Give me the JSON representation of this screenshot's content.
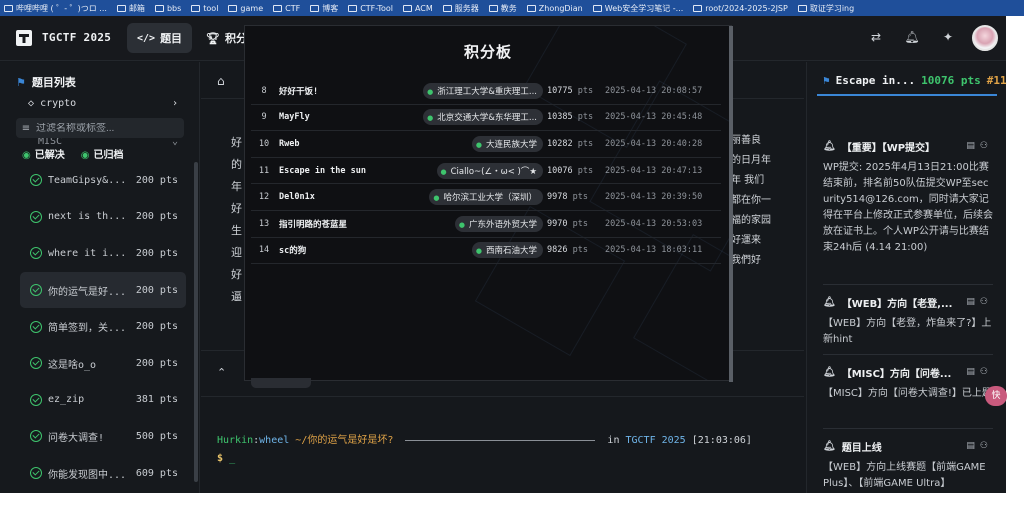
{
  "bookmarks": [
    {
      "label": "哔哩哔哩 ( ゜- ゜)つロ ..."
    },
    {
      "label": "邮箱"
    },
    {
      "label": "bbs"
    },
    {
      "label": "tool"
    },
    {
      "label": "game"
    },
    {
      "label": "CTF"
    },
    {
      "label": "博客"
    },
    {
      "label": "CTF-Tool"
    },
    {
      "label": "ACM"
    },
    {
      "label": "服务器"
    },
    {
      "label": "教务"
    },
    {
      "label": "ZhongDian"
    },
    {
      "label": "Web安全学习笔记 -..."
    },
    {
      "label": "root/2024-2025-2JSP"
    },
    {
      "label": "取证学习ing"
    }
  ],
  "header": {
    "brand": "TGCTF 2025",
    "tab_challenges": "题目",
    "tab_scoreboard": "积分"
  },
  "sidebar": {
    "title": "题目列表",
    "category": "crypto",
    "filter_placeholder": "过滤名称或标签...",
    "misc_peek": "MISC",
    "solved_label": "已解决",
    "archived_label": "已归档",
    "challenges": [
      {
        "name": "TeamGipsy&...",
        "points": "200 pts"
      },
      {
        "name": "next is th...",
        "points": "200 pts"
      },
      {
        "name": "where it i...",
        "points": "200 pts"
      },
      {
        "name": "你的运气是好...",
        "points": "200 pts"
      },
      {
        "name": "简单签到，关...",
        "points": "200 pts"
      },
      {
        "name": "这是啥o_o",
        "points": "200 pts"
      },
      {
        "name": "ez_zip",
        "points": "381 pts"
      },
      {
        "name": "问卷大调查!",
        "points": "500 pts"
      },
      {
        "name": "你能发现图中...",
        "points": "609 pts"
      }
    ]
  },
  "center": {
    "left_chars": [
      "好",
      "的",
      "年",
      "好",
      "生",
      "迎",
      "好",
      "逼"
    ],
    "right_lines": [
      "丽善良",
      "的日月年",
      "年 我们",
      "都在你一",
      "福的家园",
      "好運来",
      "我們好"
    ],
    "float_label": "快",
    "terminal": {
      "user": "Hurkin",
      "host": "wheel",
      "path": "~/你的运气是好是坏?",
      "in_label": "in",
      "ctf": "TGCTF 2025",
      "time": "[21:03:06]",
      "prompt": "$",
      "cursor": "_"
    }
  },
  "right_panel": {
    "team": "Escape in...",
    "score": "10076 pts",
    "rank": "#11",
    "float_label": "快",
    "notices": [
      {
        "title": "【重要】【WP提交】",
        "body": "WP提交: 2025年4月13日21:00比赛结束前，排名前50队伍提交WP至security514@126.com，同时请大家记得在平台上修改正式参赛单位，后续会放在证书上。个人WP公开请与比赛结束24h后 (4.14 21:00)"
      },
      {
        "title": "【WEB】方向【老登,...",
        "body": "【WEB】方向【老登，炸鱼来了?】上新hint"
      },
      {
        "title": "【MISC】方向【问卷...",
        "body": "【MISC】方向【问卷大调查!】已上题"
      },
      {
        "title": "题目上线",
        "body": "【WEB】方向上线赛题【前端GAME Plus】、【前端GAME Ultra】"
      }
    ]
  },
  "scoreboard": {
    "title": "积分板",
    "unit": "pts",
    "rows": [
      {
        "rank": "8",
        "team": "好好干饭!",
        "school": "浙江理工大学&重庆理工...",
        "score": "10775",
        "time": "2025-04-13 20:08:57"
      },
      {
        "rank": "9",
        "team": "MayFly",
        "school": "北京交通大学&东华理工...",
        "score": "10385",
        "time": "2025-04-13 20:45:48"
      },
      {
        "rank": "10",
        "team": "Rweb",
        "school": "大连民族大学",
        "score": "10282",
        "time": "2025-04-13 20:40:28"
      },
      {
        "rank": "11",
        "team": "Escape in the sun",
        "school": "Ciallo~(∠・ω< )⌒★",
        "score": "10076",
        "time": "2025-04-13 20:47:13"
      },
      {
        "rank": "12",
        "team": "Del0n1x",
        "school": "哈尔滨工业大学（深圳）",
        "score": "9978",
        "time": "2025-04-13 20:39:50"
      },
      {
        "rank": "13",
        "team": "指引明路的苍蓝星",
        "school": "广东外语外贸大学",
        "score": "9970",
        "time": "2025-04-13 20:53:03"
      },
      {
        "rank": "14",
        "team": "sc的狗",
        "school": "西南石油大学",
        "score": "9826",
        "time": "2025-04-13 18:03:11"
      }
    ]
  }
}
